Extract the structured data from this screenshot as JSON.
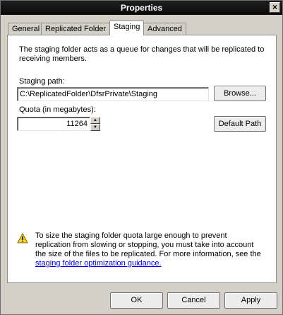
{
  "window": {
    "title": "Properties",
    "close_glyph": "×"
  },
  "tabs": [
    {
      "label": "General"
    },
    {
      "label": "Replicated Folder"
    },
    {
      "label": "Staging"
    },
    {
      "label": "Advanced"
    }
  ],
  "active_tab": "Staging",
  "staging": {
    "description_line1": "The staging folder acts as a queue for changes that will be replicated to",
    "description_line2": "receiving members.",
    "path_label": "Staging path:",
    "path_value": "C:\\ReplicatedFolder\\DfsrPrivate\\Staging",
    "browse_label": "Browse...",
    "quota_label": "Quota (in megabytes):",
    "quota_value": "11264",
    "default_path_label": "Default Path",
    "warning_line1": "To size the staging folder quota large enough to prevent",
    "warning_line2": "replication from slowing or stopping, you must take into account",
    "warning_line3": "the size of the files to be replicated. For more information, see the",
    "warning_link": "staging folder optimization guidance."
  },
  "buttons": {
    "ok": "OK",
    "cancel": "Cancel",
    "apply": "Apply"
  },
  "icons": {
    "warning": "warning-icon",
    "spin_up": "arrow-up-icon",
    "spin_down": "arrow-down-icon"
  }
}
